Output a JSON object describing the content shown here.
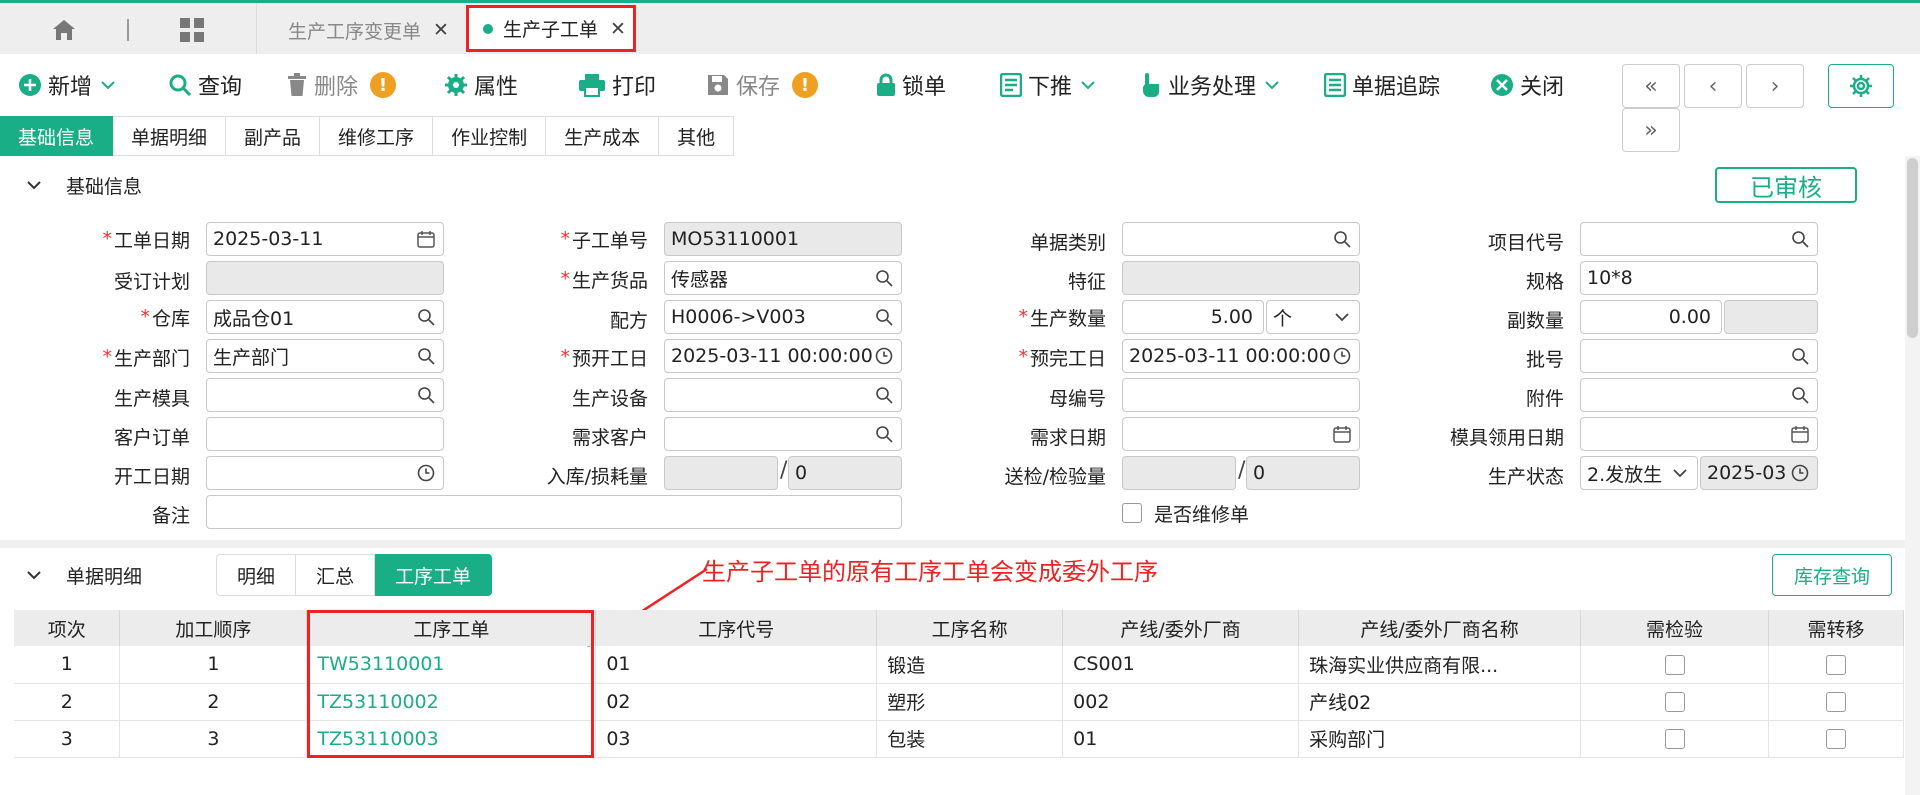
{
  "tabs": {
    "inactive": "生产工序变更单",
    "active": "生产子工单"
  },
  "toolbar": {
    "add": "新增",
    "query": "查询",
    "delete": "删除",
    "properties": "属性",
    "print": "打印",
    "save": "保存",
    "lock": "锁单",
    "push_down": "下推",
    "business": "业务处理",
    "trace": "单据追踪",
    "close": "关闭",
    "warn_mark": "!"
  },
  "subtabs": [
    "基础信息",
    "单据明细",
    "副产品",
    "维修工序",
    "作业控制",
    "生产成本",
    "其他"
  ],
  "basic": {
    "header": "基础信息",
    "status": "已审核",
    "labels": {
      "order_date": "工单日期",
      "sub_no": "子工单号",
      "doc_type": "单据类别",
      "project_code": "项目代号",
      "plan": "受订计划",
      "goods": "生产货品",
      "feature": "特征",
      "spec": "规格",
      "warehouse": "仓库",
      "formula": "配方",
      "qty": "生产数量",
      "sub_qty": "副数量",
      "dept": "生产部门",
      "plan_start": "预开工日",
      "plan_end": "预完工日",
      "batch": "批号",
      "mold": "生产模具",
      "equipment": "生产设备",
      "parent_no": "母编号",
      "attachment": "附件",
      "customer_order": "客户订单",
      "demand_customer": "需求客户",
      "demand_date": "需求日期",
      "mold_date": "模具领用日期",
      "start_date": "开工日期",
      "in_loss": "入库/损耗量",
      "inspect": "送检/检验量",
      "prod_status": "生产状态",
      "remark": "备注",
      "is_repair": "是否维修单"
    },
    "values": {
      "order_date": "2025-03-11",
      "sub_no": "MO53110001",
      "goods": "传感器",
      "spec": "10*8",
      "warehouse": "成品仓01",
      "formula": "H0006->V003",
      "qty": "5.00",
      "unit": "个",
      "sub_qty": "0.00",
      "dept": "生产部门",
      "plan_start": "2025-03-11 00:00:00",
      "plan_end": "2025-03-11 00:00:00",
      "loss": "0",
      "inspected": "0",
      "prod_status": "2.发放生",
      "status_date": "2025-03"
    }
  },
  "detail": {
    "header": "单据明细",
    "tabs": [
      "明细",
      "汇总",
      "工序工单"
    ],
    "stock_button": "库存查询",
    "annotation": "生产子工单的原有工序工单会变成委外工序",
    "columns": [
      "项次",
      "加工顺序",
      "工序工单",
      "工序代号",
      "工序名称",
      "产线/委外厂商",
      "产线/委外厂商名称",
      "需检验",
      "需转移"
    ],
    "rows": [
      {
        "item": "1",
        "seq": "1",
        "work_order": "TW53110001",
        "op_code": "01",
        "op_name": "锻造",
        "line": "CS001",
        "line_name": "珠海实业供应商有限..."
      },
      {
        "item": "2",
        "seq": "2",
        "work_order": "TZ53110002",
        "op_code": "02",
        "op_name": "塑形",
        "line": "002",
        "line_name": "产线02"
      },
      {
        "item": "3",
        "seq": "3",
        "work_order": "TZ53110003",
        "op_code": "03",
        "op_name": "包装",
        "line": "01",
        "line_name": "采购部门"
      }
    ]
  },
  "colors": {
    "accent": "#1aae87",
    "highlight": "#e22222",
    "warning": "#f0a020"
  }
}
